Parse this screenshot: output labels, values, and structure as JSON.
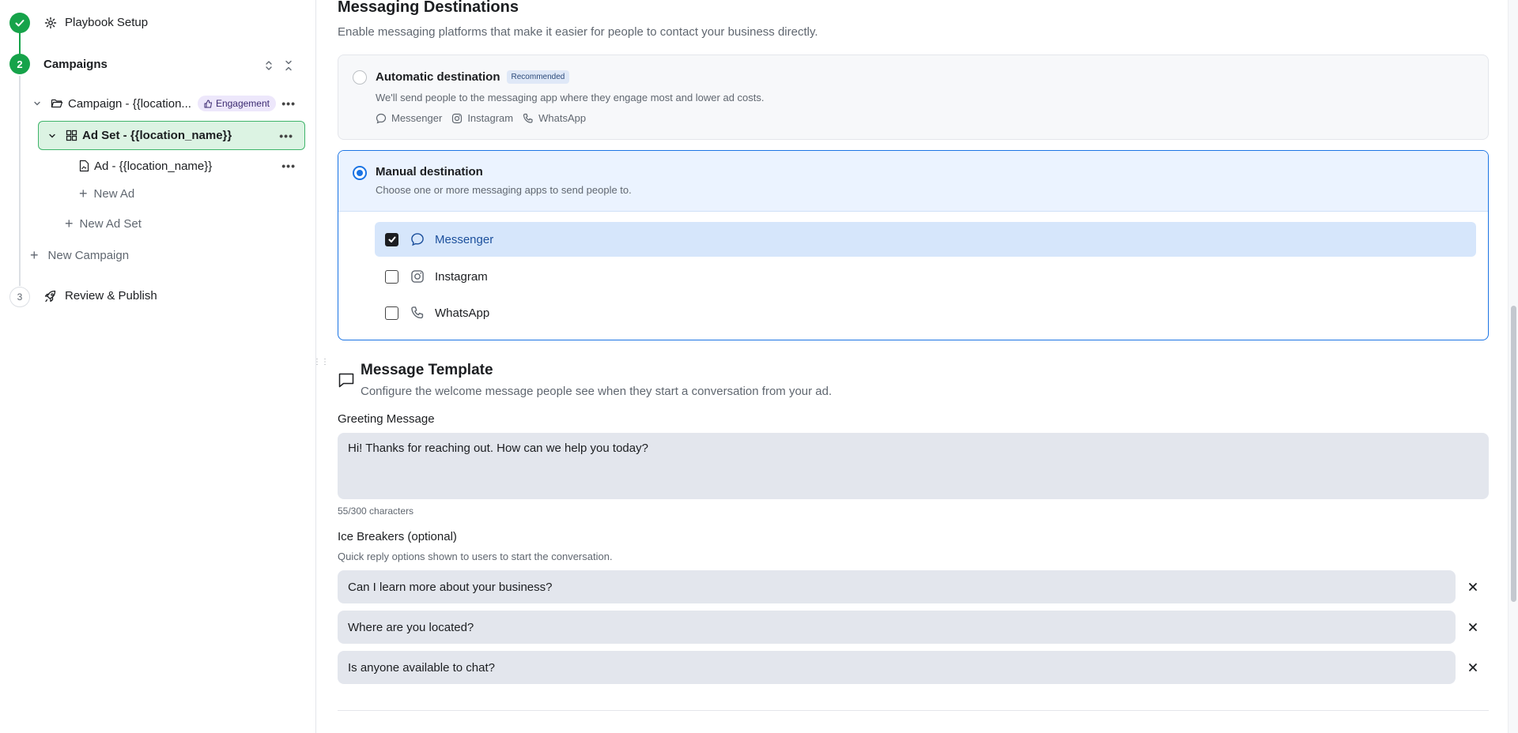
{
  "sidebar": {
    "steps": [
      {
        "number": "",
        "label": "Playbook Setup",
        "status": "done"
      },
      {
        "number": "2",
        "label": "Campaigns",
        "status": "active"
      },
      {
        "number": "3",
        "label": "Review & Publish",
        "status": "todo"
      }
    ],
    "campaign": {
      "label": "Campaign - {{location...",
      "badge": "Engagement"
    },
    "ad_set": {
      "label": "Ad Set - {{location_name}}"
    },
    "ad": {
      "label": "Ad - {{location_name}}"
    },
    "new_ad": "New Ad",
    "new_ad_set": "New Ad Set",
    "new_campaign": "New Campaign"
  },
  "main": {
    "messaging": {
      "title": "Messaging Destinations",
      "subtitle": "Enable messaging platforms that make it easier for people to contact your business directly.",
      "automatic": {
        "title": "Automatic destination",
        "badge": "Recommended",
        "description": "We'll send people to the messaging app where they engage most and lower ad costs.",
        "apps": [
          "Messenger",
          "Instagram",
          "WhatsApp"
        ],
        "selected": false
      },
      "manual": {
        "title": "Manual destination",
        "description": "Choose one or more messaging apps to send people to.",
        "selected": true,
        "options": [
          {
            "label": "Messenger",
            "checked": true,
            "icon": "messenger-icon"
          },
          {
            "label": "Instagram",
            "checked": false,
            "icon": "instagram-icon"
          },
          {
            "label": "WhatsApp",
            "checked": false,
            "icon": "whatsapp-icon"
          }
        ]
      }
    },
    "template": {
      "title": "Message Template",
      "subtitle": "Configure the welcome message people see when they start a conversation from your ad.",
      "greeting_label": "Greeting Message",
      "greeting_value": "Hi! Thanks for reaching out. How can we help you today?",
      "char_count": "55/300 characters",
      "ice_label": "Ice Breakers (optional)",
      "ice_sub": "Quick reply options shown to users to start the conversation.",
      "ice_breakers": [
        "Can I learn more about your business?",
        "Where are you located?",
        "Is anyone available to chat?"
      ]
    }
  },
  "colors": {
    "accent_green": "#16a34a",
    "accent_blue": "#1b74e4",
    "selected_row": "#d6e6fb",
    "input_bg": "#e3e6ed"
  }
}
